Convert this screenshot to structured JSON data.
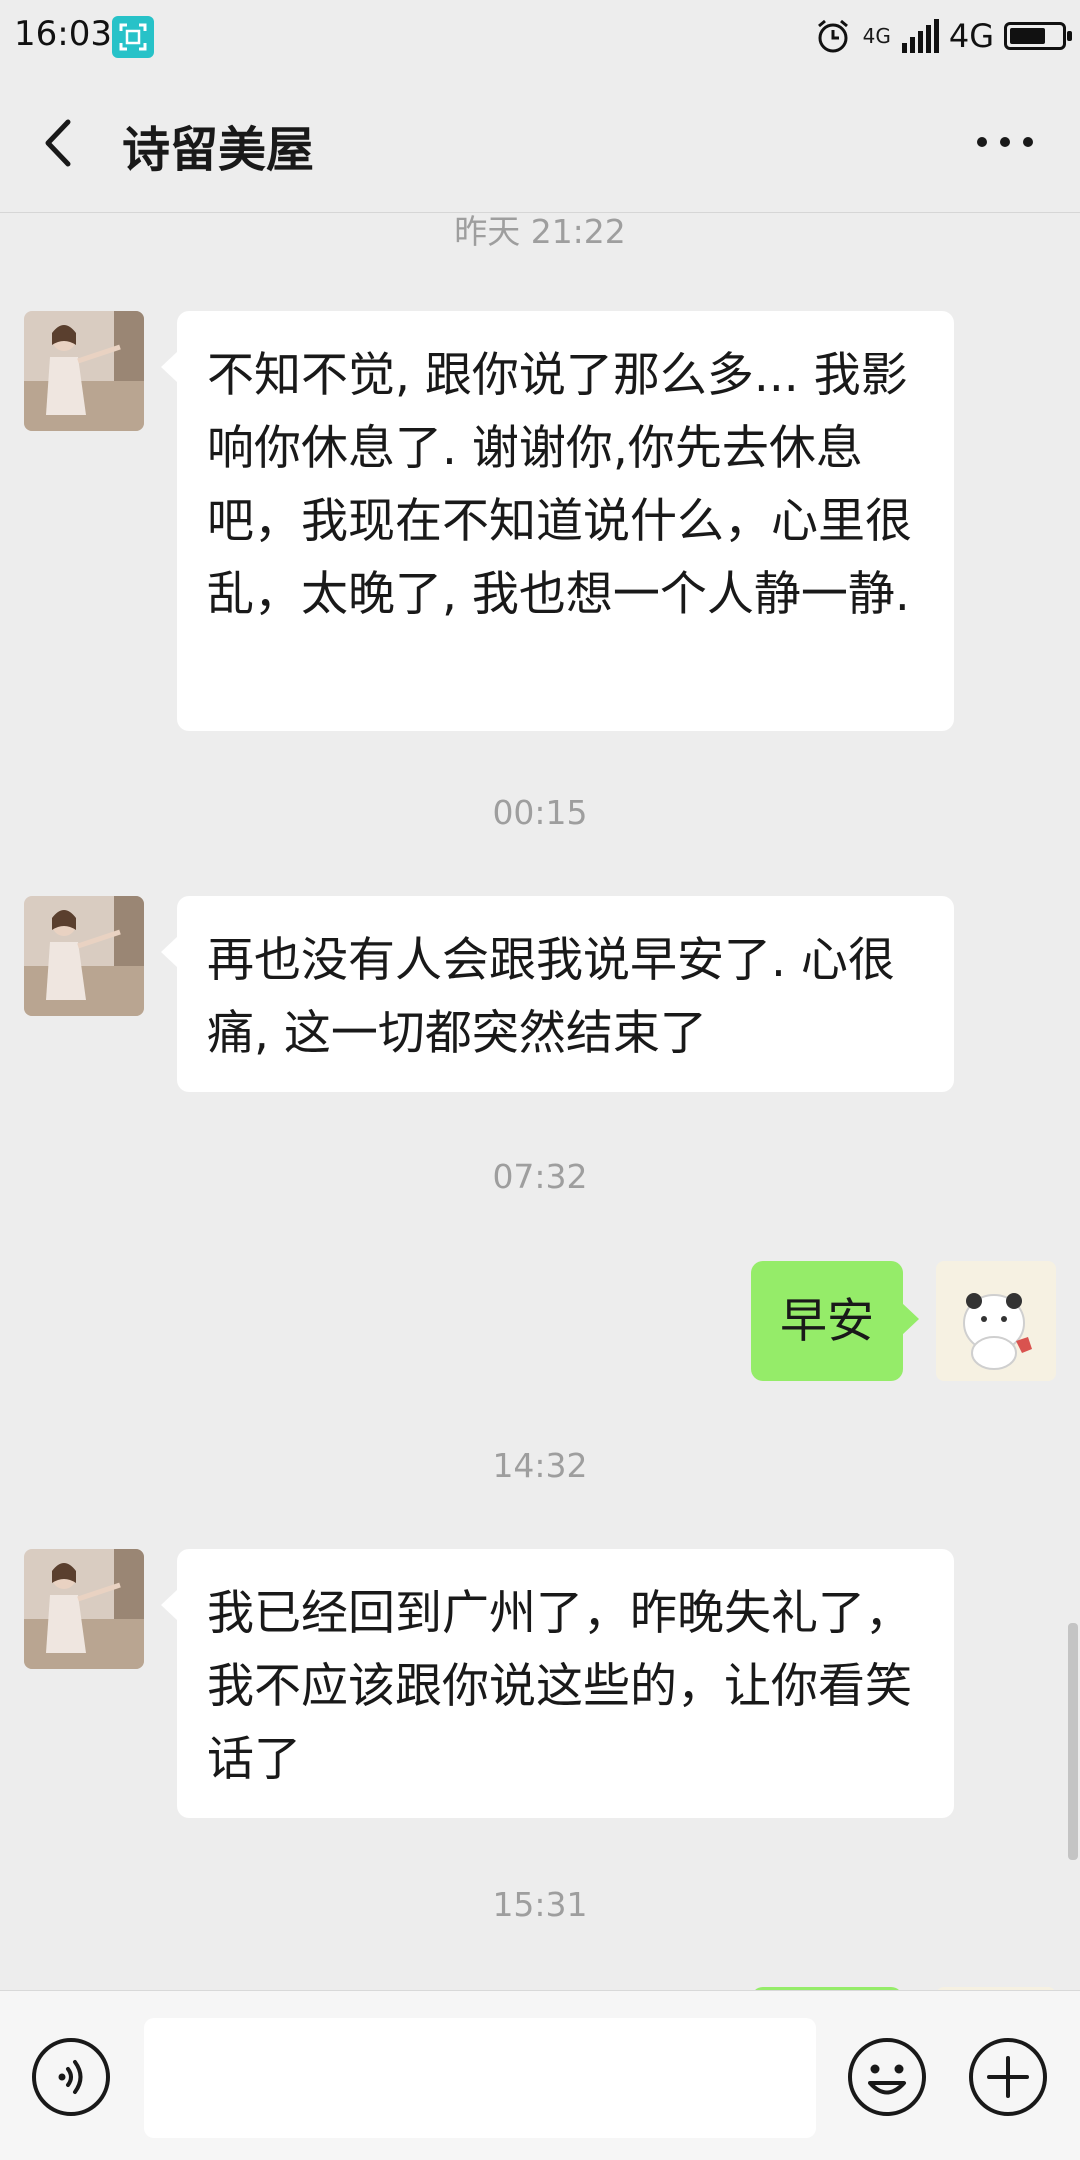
{
  "status_bar": {
    "time": "16:03",
    "network_small": "4G",
    "network_label": "4G",
    "battery_level": 0.7
  },
  "header": {
    "title": "诗留美屋"
  },
  "messages": [
    {
      "type": "time",
      "text": "昨天 21:22"
    },
    {
      "type": "msg",
      "from": "other",
      "text": "不知不觉, 跟你说了那么多... 我影响你休息了. 谢谢你,你先去休息吧，我现在不知道说什么，心里很乱，太晚了, 我也想一个人静一静."
    },
    {
      "type": "time",
      "text": "00:15"
    },
    {
      "type": "msg",
      "from": "other",
      "text": " 再也没有人会跟我说早安了. 心很痛, 这一切都突然结束了"
    },
    {
      "type": "time",
      "text": "07:32"
    },
    {
      "type": "msg",
      "from": "me",
      "text": "早安"
    },
    {
      "type": "time",
      "text": "14:32"
    },
    {
      "type": "msg",
      "from": "other",
      "text": "我已经回到广州了，昨晚失礼了，我不应该跟你说这些的，让你看笑话了"
    },
    {
      "type": "time",
      "text": "15:31"
    }
  ],
  "input": {
    "value": ""
  },
  "colors": {
    "background": "#ededed",
    "incoming_bubble": "#ffffff",
    "outgoing_bubble": "#95ec69",
    "timestamp": "#9e9e9e",
    "input_bar": "#f6f6f6"
  },
  "icons": [
    "back-arrow-icon",
    "more-dots-icon",
    "voice-icon",
    "emoji-icon",
    "plus-icon",
    "alarm-icon",
    "signal-icon",
    "battery-icon",
    "scan-icon"
  ]
}
